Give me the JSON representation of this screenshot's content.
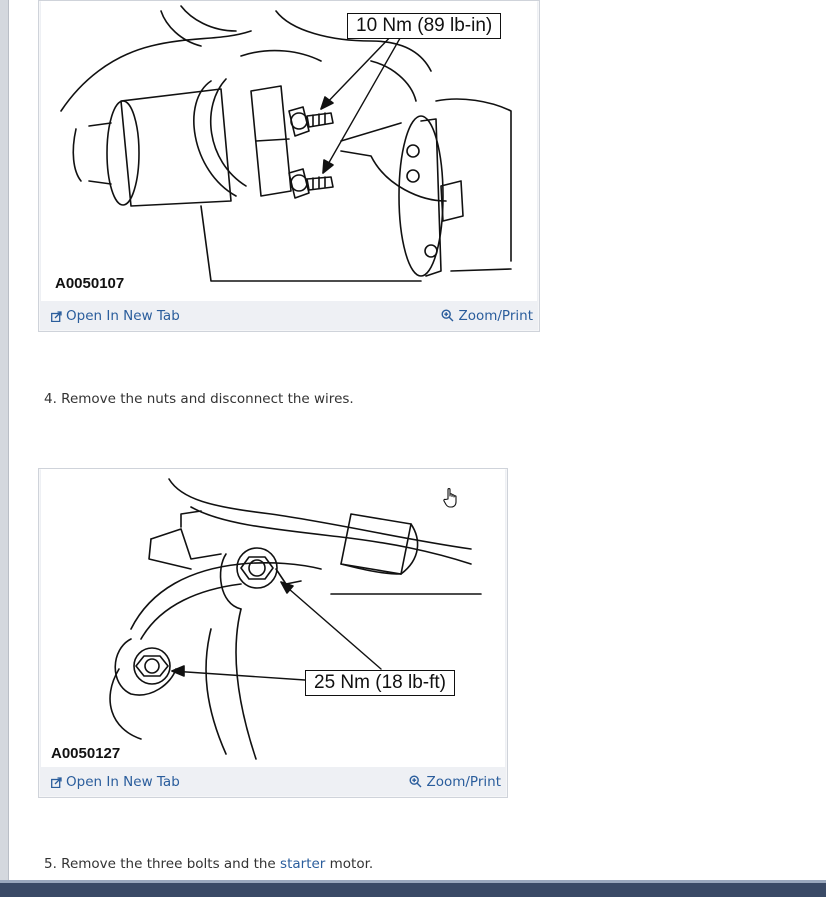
{
  "figures": [
    {
      "id": "A0050107",
      "callout": "10 Nm (89 lb-in)",
      "open_label": "Open In New Tab",
      "zoom_label": "Zoom/Print"
    },
    {
      "id": "A0050127",
      "callout": "25 Nm (18 lb-ft)",
      "open_label": "Open In New Tab",
      "zoom_label": "Zoom/Print"
    }
  ],
  "steps": [
    {
      "text": "4. Remove the nuts and disconnect the wires."
    },
    {
      "prefix": "5. Remove the three bolts and the ",
      "link": "starter",
      "suffix": " motor."
    }
  ],
  "colors": {
    "link": "#2a5d9c",
    "text": "#333333",
    "figure_bg": "#eef0f4"
  },
  "icons": [
    "open-new-tab-icon",
    "zoom-icon",
    "hand-cursor-icon"
  ]
}
